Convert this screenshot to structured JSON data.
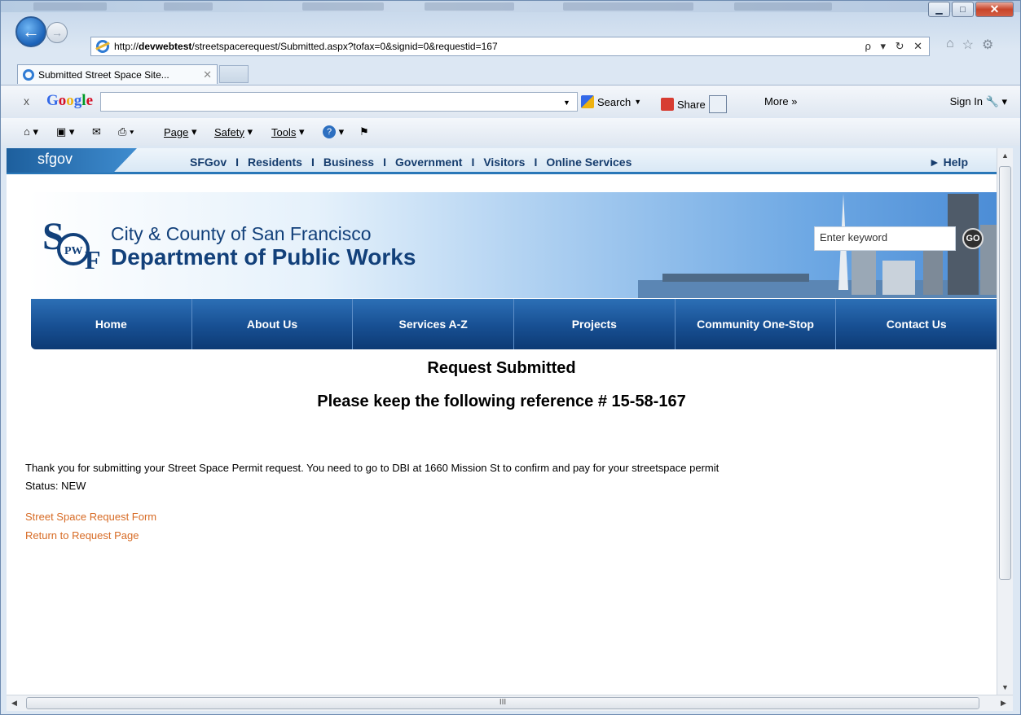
{
  "browser": {
    "url_prefix": "http://",
    "url_host": "devwebtest",
    "url_path": "/streetspacerequest/Submitted.aspx?tofax=0&signid=0&requestid=167",
    "tab_title": "Submitted Street Space Site...",
    "address_controls": "ρ ▾ ↻ ✕"
  },
  "google_toolbar": {
    "logo": "Google",
    "search_label": "Search",
    "share_label": "Share",
    "more_label": "More »",
    "signin_label": "Sign In"
  },
  "command_bar": {
    "page_label": "Page",
    "safety_label": "Safety",
    "tools_label": "Tools"
  },
  "sfgov": {
    "logo": "sfgov",
    "links": [
      "SFGov",
      "Residents",
      "Business",
      "Government",
      "Visitors",
      "Online Services"
    ],
    "help": "► Help"
  },
  "banner": {
    "line1": "City & County of San Francisco",
    "line2": "Department of Public Works",
    "search_placeholder": "Enter keyword",
    "go_label": "GO"
  },
  "nav": [
    "Home",
    "About Us",
    "Services A-Z",
    "Projects",
    "Community One-Stop",
    "Contact Us"
  ],
  "content": {
    "heading": "Request Submitted",
    "reference": "Please keep the following reference # 15-58-167",
    "message": "Thank you for submitting your Street Space Permit request. You need to go to DBI at 1660 Mission St to confirm and pay for your streetspace permit",
    "status": "Status: NEW",
    "link1": "Street Space Request Form",
    "link2": "Return to Request Page"
  },
  "scrollbar": {
    "h_grip": "III"
  }
}
